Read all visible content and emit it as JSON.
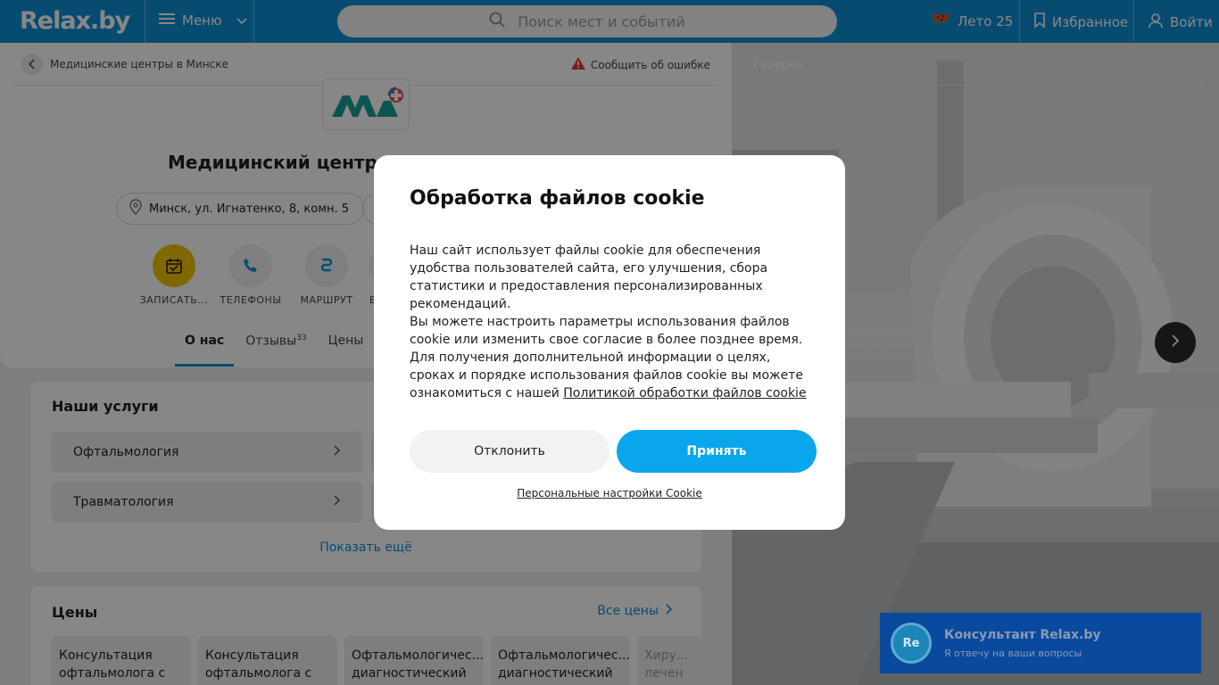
{
  "header": {
    "logo": "Relax.by",
    "menu_label": "Меню",
    "search_placeholder": "Поиск мест и событий",
    "summer_label": "Лето 25",
    "favorites_label": "Избранное",
    "login_label": "Войти"
  },
  "page": {
    "breadcrumb": "Медицинские центры в Минске",
    "report_label": "Сообщить об ошибке",
    "title": "Медицинский центр",
    "address": "Минск, ул. Игнатенко, 8, комн. 5",
    "actions": [
      "ЗАПИСАТЬ...",
      "ТЕЛЕФОНЫ",
      "МАРШРУТ",
      "В"
    ],
    "tabs": {
      "about": "О нас",
      "reviews": "Отзывы",
      "reviews_count": "33",
      "prices": "Цены"
    }
  },
  "services": {
    "title": "Наши услуги",
    "items": [
      "Офтальмология",
      "Травматология"
    ],
    "show_more": "Показать ещё"
  },
  "prices": {
    "title": "Цены",
    "all_link": "Все цены",
    "items": [
      "Консультация офтальмолога с",
      "Консультация офтальмолога с",
      "Офтальмологичес... диагностический",
      "Офтальмологичес... диагностический",
      "Хиру... лечен"
    ]
  },
  "gallery": {
    "title": "Галерея"
  },
  "cookie": {
    "title": "Обработка файлов cookie",
    "paragraph1": "Наш сайт использует файлы cookie для обеспечения удобства пользователей сайта, его улучшения, сбора статистики и предоставления персонализированных рекомендаций.",
    "paragraph2": "Вы можете настроить параметры использования файлов cookie или изменить свое согласие в более позднее время. Для получения дополнительной информации о целях, сроках и порядке использования файлов cookie вы можете ознакомиться с нашей",
    "policy_link": "Политикой обработки файлов cookie",
    "decline": "Отклонить",
    "accept": "Принять",
    "personal_settings": "Персональные настройки Cookie"
  },
  "chat": {
    "avatar": "Re",
    "title": "Консультант Relax.by",
    "subtitle": "Я отвечу на ваши вопросы"
  },
  "colors": {
    "brand": "#0f8fd6",
    "accept": "#0aa6ec",
    "chat": "#0a4a9e",
    "calendar": "#f2c200"
  }
}
